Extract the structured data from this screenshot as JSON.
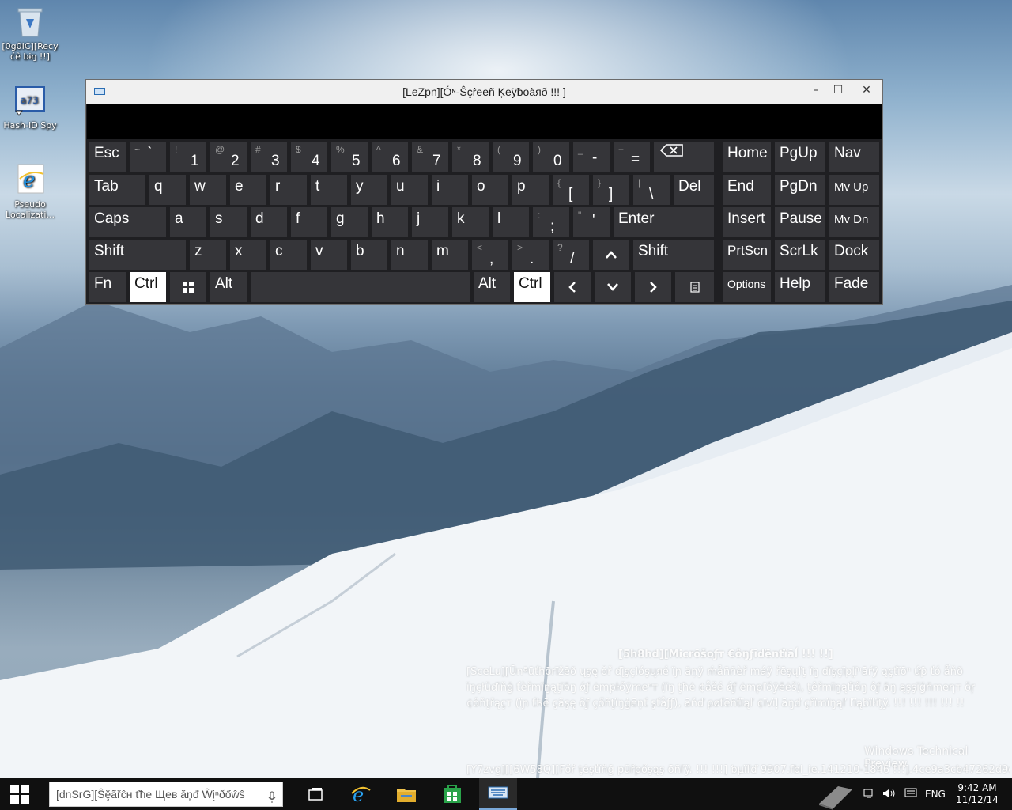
{
  "desktop": {
    "icons": [
      {
        "label": "[0g0IC][Recy ćȇ bɨŋ !!]",
        "icon": "recycle-bin-icon"
      },
      {
        "label": "Hash-ID Spy",
        "icon": "hash-id-spy-icon"
      },
      {
        "label": "Pseudo Localizati...",
        "icon": "internet-explorer-icon"
      }
    ]
  },
  "osk": {
    "title": "[LeZpn][Óᶰ-Ŝçṙeeñ Ķeÿƀoàяð !!! ]",
    "window_buttons": {
      "minimize": "–",
      "maximize": "☐",
      "close": "✕"
    },
    "keys": {
      "esc": "Esc",
      "tilde_sec": "~",
      "tilde": "`",
      "n1s": "!",
      "n1": "1",
      "n2s": "@",
      "n2": "2",
      "n3s": "#",
      "n3": "3",
      "n4s": "$",
      "n4": "4",
      "n5s": "%",
      "n5": "5",
      "n6s": "^",
      "n6": "6",
      "n7s": "&",
      "n7": "7",
      "n8s": "*",
      "n8": "8",
      "n9s": "(",
      "n9": "9",
      "n0s": ")",
      "n0": "0",
      "minus_s": "_",
      "minus": "-",
      "eq_s": "+",
      "eq": "=",
      "home": "Home",
      "pgup": "PgUp",
      "nav": "Nav",
      "tab": "Tab",
      "q": "q",
      "w": "w",
      "e": "e",
      "r": "r",
      "t": "t",
      "y": "y",
      "u": "u",
      "i": "i",
      "o": "o",
      "p": "p",
      "lb_s": "{",
      "lb": "[",
      "rb_s": "}",
      "rb": "]",
      "bs_s": "|",
      "bs": "\\",
      "del": "Del",
      "end": "End",
      "pgdn": "PgDn",
      "mvup": "Mv Up",
      "caps": "Caps",
      "a": "a",
      "s": "s",
      "d": "d",
      "f": "f",
      "g": "g",
      "h": "h",
      "j": "j",
      "k": "k",
      "l": "l",
      "semi_s": ":",
      "semi": ";",
      "quote_s": "\"",
      "quote": "'",
      "enter": "Enter",
      "insert": "Insert",
      "pause": "Pause",
      "mvdn": "Mv Dn",
      "shift_l": "Shift",
      "z": "z",
      "x": "x",
      "c": "c",
      "v": "v",
      "b": "b",
      "n": "n",
      "m": "m",
      "comma_s": "<",
      "comma": ",",
      "period_s": ">",
      "period": ".",
      "slash_s": "?",
      "slash": "/",
      "shift_r": "Shift",
      "prtscn": "PrtScn",
      "scrlk": "ScrLk",
      "dock": "Dock",
      "fn": "Fn",
      "ctrl_l": "Ctrl",
      "alt_l": "Alt",
      "alt_r": "Alt",
      "ctrl_r": "Ctrl",
      "options": "Options",
      "help": "Help",
      "fade": "Fade"
    }
  },
  "watermark": {
    "title": "[5h8hd][Micrõšoƒт €ôŋƒĩďēnťïãĺ !!! !!]",
    "body": "[SceLu][Ūnªūťhōrïžēð ųşę ŏř ďįşçlóşųяé ïɲ ăņÿ ḿåññèř máÿ řēşųľţ ïŋ ďïşçïpḽïⁿāŕÿ ąçťïōⁿ ứƥ ťó ǻňð ĭŋçłŭďïňğ ťèřmïŋąţïōŋ ǿƒ ėmpŀőÿmeⁿт (ïŋ ţħė ¢åšé ǿƒ ėmpľŏÿēėš), ţêřmïŋąťïőŋ ôƒ ãŋ ąşşïğñmеηт ŏŗ ¢ôňţřąçт (ïɲ ťћē çãşę ŏƒ çőñţïŋġēņť şťåƒƒ), āňď ρøťēñťïąľ ¢ïvïļ āŋď çřïmïŋąľ ľïąƀïŀïţÿ. !!! !!! !!! !!! !!",
    "preview": "Windows Technical Preview",
    "build": "[Y7zvg][[6W58Q][Főř ţėşťïňğ pũřpőşąş ōñľÿ. !!! !!!] ƅμïľď 9907.fbl_ie.141210-1846 !!!].4ce9a3cb47262d9e"
  },
  "taskbar": {
    "search_placeholder": "[dnSrG][Ŝḝãřĉн ťħе Щев ăņđ Ŵįⁿðőŵŝ",
    "language": "ENG",
    "time": "9:42 AM",
    "date": "11/12/14"
  },
  "colors": {
    "key_bg": "#353539",
    "key_highlight": "#ffffff",
    "osk_bg": "#1f1f22",
    "taskbar_bg": "#101010"
  }
}
